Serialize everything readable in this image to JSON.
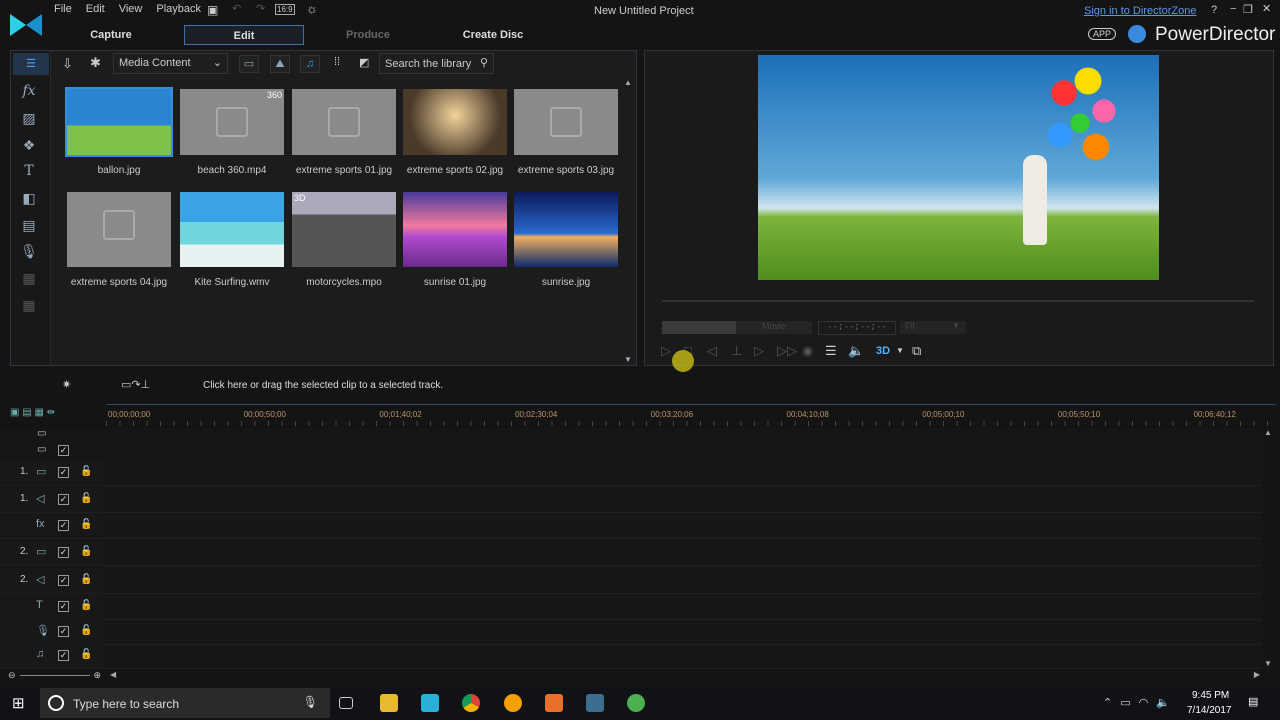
{
  "menu": [
    "File",
    "Edit",
    "View",
    "Playback"
  ],
  "aspect": "16:9",
  "window_title": "New Untitled Project",
  "sign_in": "Sign in to DirectorZone",
  "app_badge": "APP",
  "brand": "PowerDirector",
  "tabs": [
    "Capture",
    "Edit",
    "Produce",
    "Create Disc"
  ],
  "library": {
    "dropdown": "Media Content",
    "search_placeholder": "Search the library",
    "items": [
      {
        "name": "ballon.jpg",
        "kind": "balloon"
      },
      {
        "name": "beach 360.mp4",
        "kind": "placeholder",
        "badge": "360"
      },
      {
        "name": "extreme sports 01.jpg",
        "kind": "placeholder"
      },
      {
        "name": "extreme sports 02.jpg",
        "kind": "moto"
      },
      {
        "name": "extreme sports 03.jpg",
        "kind": "placeholder"
      },
      {
        "name": "extreme sports 04.jpg",
        "kind": "placeholder"
      },
      {
        "name": "Kite Surfing.wmv",
        "kind": "sea"
      },
      {
        "name": "motorcycles.mpo",
        "kind": "bikes",
        "badge": "3D"
      },
      {
        "name": "sunrise 01.jpg",
        "kind": "sunrise1"
      },
      {
        "name": "sunrise.jpg",
        "kind": "sunrise2"
      }
    ]
  },
  "preview": {
    "mode": "Movie",
    "timecode": "--;--;--;--",
    "zoom": "Fit",
    "threed": "3D"
  },
  "timeline": {
    "hint": "Click here or drag the selected clip to a selected track.",
    "ruler": [
      "00;00;00;00",
      "00;00;50;00",
      "00;01;40;02",
      "00;02;30;04",
      "00;03;20;06",
      "00;04;10;08",
      "00;05;00;10",
      "00;05;50;10",
      "00;06;40;12"
    ],
    "tracks": [
      {
        "num": "1.",
        "icon": "video"
      },
      {
        "num": "1.",
        "icon": "audio"
      },
      {
        "num": "",
        "icon": "fx"
      },
      {
        "num": "2.",
        "icon": "video"
      },
      {
        "num": "2.",
        "icon": "audio"
      },
      {
        "num": "",
        "icon": "title"
      },
      {
        "num": "",
        "icon": "voice"
      },
      {
        "num": "",
        "icon": "music"
      }
    ]
  },
  "taskbar": {
    "search": "Type here to search",
    "time": "9:45 PM",
    "date": "7/14/2017"
  }
}
